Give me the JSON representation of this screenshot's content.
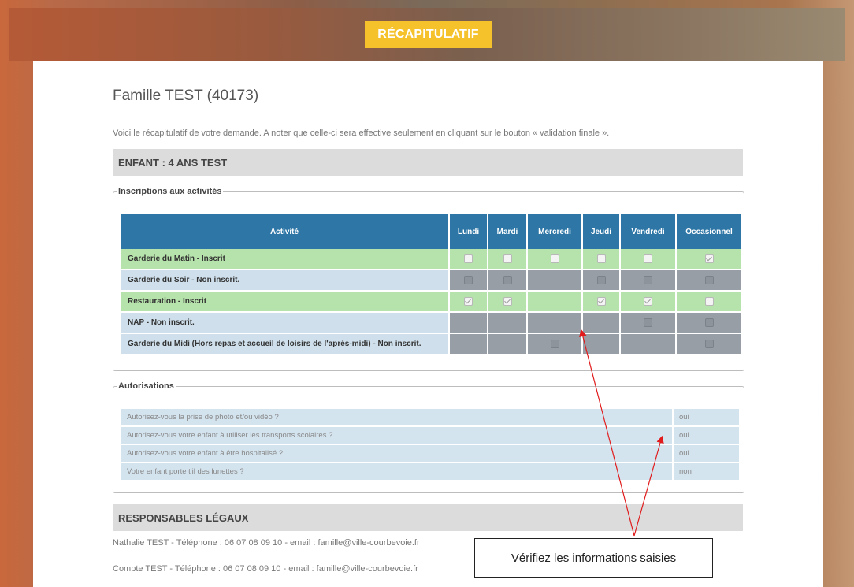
{
  "header": {
    "title": "RÉCAPITULATIF"
  },
  "family": {
    "title": "Famille TEST (40173)"
  },
  "intro": "Voici le récapitulatif de votre demande. A noter que celle-ci sera effective seulement en cliquant sur le bouton « validation finale ».",
  "child": {
    "header": "ENFANT : 4 ANS TEST"
  },
  "activities": {
    "legend": "Inscriptions aux activités",
    "columns": [
      "Activité",
      "Lundi",
      "Mardi",
      "Mercredi",
      "Jeudi",
      "Vendredi",
      "Occasionnel"
    ],
    "rows": [
      {
        "label": "Garderie du Matin - Inscrit",
        "status": "inscrit",
        "cells": [
          "box",
          "box",
          "box",
          "box",
          "box",
          "checked"
        ]
      },
      {
        "label": "Garderie du Soir - Non inscrit.",
        "status": "non",
        "cells": [
          "dark",
          "dark",
          "none",
          "dark",
          "dark",
          "dark"
        ]
      },
      {
        "label": "Restauration - Inscrit",
        "status": "inscrit",
        "cells": [
          "checked",
          "checked",
          "none",
          "checked",
          "checked",
          "box"
        ]
      },
      {
        "label": "NAP - Non inscrit.",
        "status": "non",
        "cells": [
          "none",
          "none",
          "none",
          "none",
          "dark",
          "dark"
        ]
      },
      {
        "label": "Garderie du Midi (Hors repas et accueil de loisirs de l'après-midi) - Non inscrit.",
        "status": "non",
        "cells": [
          "none",
          "none",
          "dark",
          "none",
          "none",
          "dark"
        ]
      }
    ]
  },
  "authorizations": {
    "legend": "Autorisations",
    "items": [
      {
        "question": "Autorisez-vous la prise de photo et/ou vidéo ?",
        "answer": "oui"
      },
      {
        "question": "Autorisez-vous votre enfant à utiliser les transports scolaires ?",
        "answer": "oui"
      },
      {
        "question": "Autorisez-vous votre enfant à être hospitalisé ?",
        "answer": "oui"
      },
      {
        "question": "Votre enfant porte t'il des lunettes ?",
        "answer": "non"
      }
    ]
  },
  "guardians": {
    "header": "RESPONSABLES LÉGAUX",
    "lines": [
      "Nathalie TEST - Téléphone : 06 07 08 09 10 - email : famille@ville-courbevoie.fr",
      "Compte TEST - Téléphone : 06 07 08 09 10 - email : famille@ville-courbevoie.fr"
    ]
  },
  "callout": {
    "text": "Vérifiez les informations saisies",
    "color": "#e11b1b"
  }
}
